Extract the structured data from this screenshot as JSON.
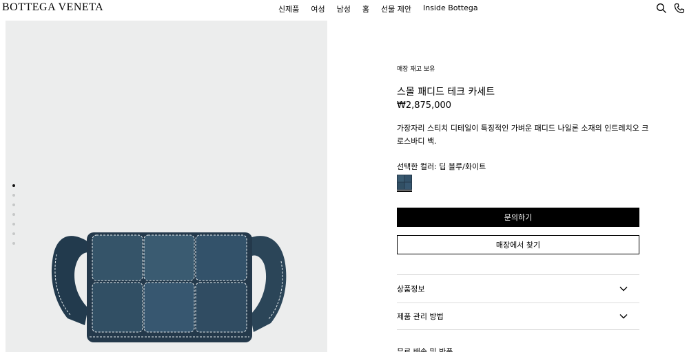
{
  "brand": {
    "logo_text": "BOTTEGA VENETA"
  },
  "nav": {
    "items": [
      {
        "label": "신제품"
      },
      {
        "label": "여성"
      },
      {
        "label": "남성"
      },
      {
        "label": "홈"
      },
      {
        "label": "선물 제안"
      },
      {
        "label": "Inside Bottega"
      }
    ]
  },
  "header_icons": [
    "search-icon",
    "phone-icon"
  ],
  "gallery": {
    "total_images": 7,
    "active_index": 0,
    "background": "#eceded"
  },
  "product": {
    "stock_status": "매장 재고 보유",
    "title": "스몰 패디드 테크 카세트",
    "price": "₩2,875,000",
    "description": "가장자리 스티치 디테일이 특징적인 가벼운 패디드 나일론 소재의 인트레치오 크로스바디 백.",
    "selected_color_label": "선택한 컬러: 딥 블루/화이트",
    "swatch_color": "#2f4b5f"
  },
  "actions": {
    "inquire_label": "문의하기",
    "find_store_label": "매장에서 찾기"
  },
  "accordion": {
    "items": [
      {
        "label": "상품정보"
      },
      {
        "label": "제품 관리 방법"
      }
    ],
    "partial_label": "무료 배송 및 반품"
  },
  "colors": {
    "primary_button_bg": "#000000",
    "bag_blue": "#2f4b5f",
    "divider": "#dcdcdc"
  }
}
